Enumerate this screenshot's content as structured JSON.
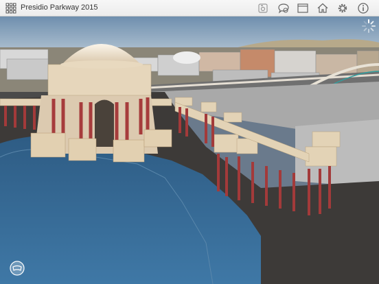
{
  "app": {
    "title": "Presidio Parkway 2015"
  },
  "toolbar": {
    "icons": [
      "grid-menu-icon",
      "camera-icon",
      "chat-icon",
      "window-icon",
      "home-icon",
      "settings-icon",
      "info-icon"
    ]
  },
  "scene": {
    "subject": "3D city view",
    "colors": {
      "water": "#3a6f9a",
      "sky": "#9fb7cf",
      "stone": "#e6d7c0",
      "column": "#b04040"
    }
  }
}
